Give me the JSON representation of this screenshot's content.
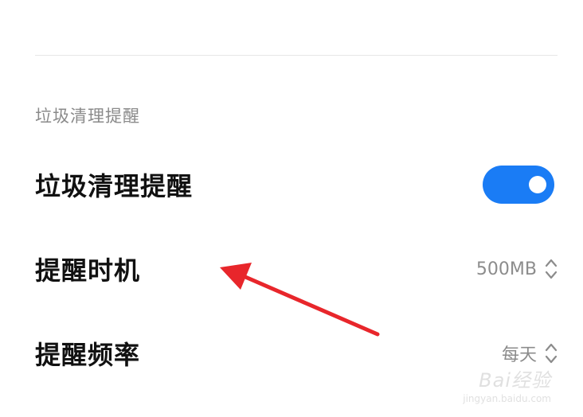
{
  "section": {
    "title": "垃圾清理提醒"
  },
  "rows": [
    {
      "label": "垃圾清理提醒",
      "toggle_on": true
    },
    {
      "label": "提醒时机",
      "value": "500MB"
    },
    {
      "label": "提醒频率",
      "value": "每天"
    }
  ],
  "colors": {
    "accent": "#1a7cf5",
    "annotation_arrow": "#e8262b"
  },
  "watermark": {
    "main": "Bai经验",
    "sub": "jingyan.baidu.com"
  }
}
